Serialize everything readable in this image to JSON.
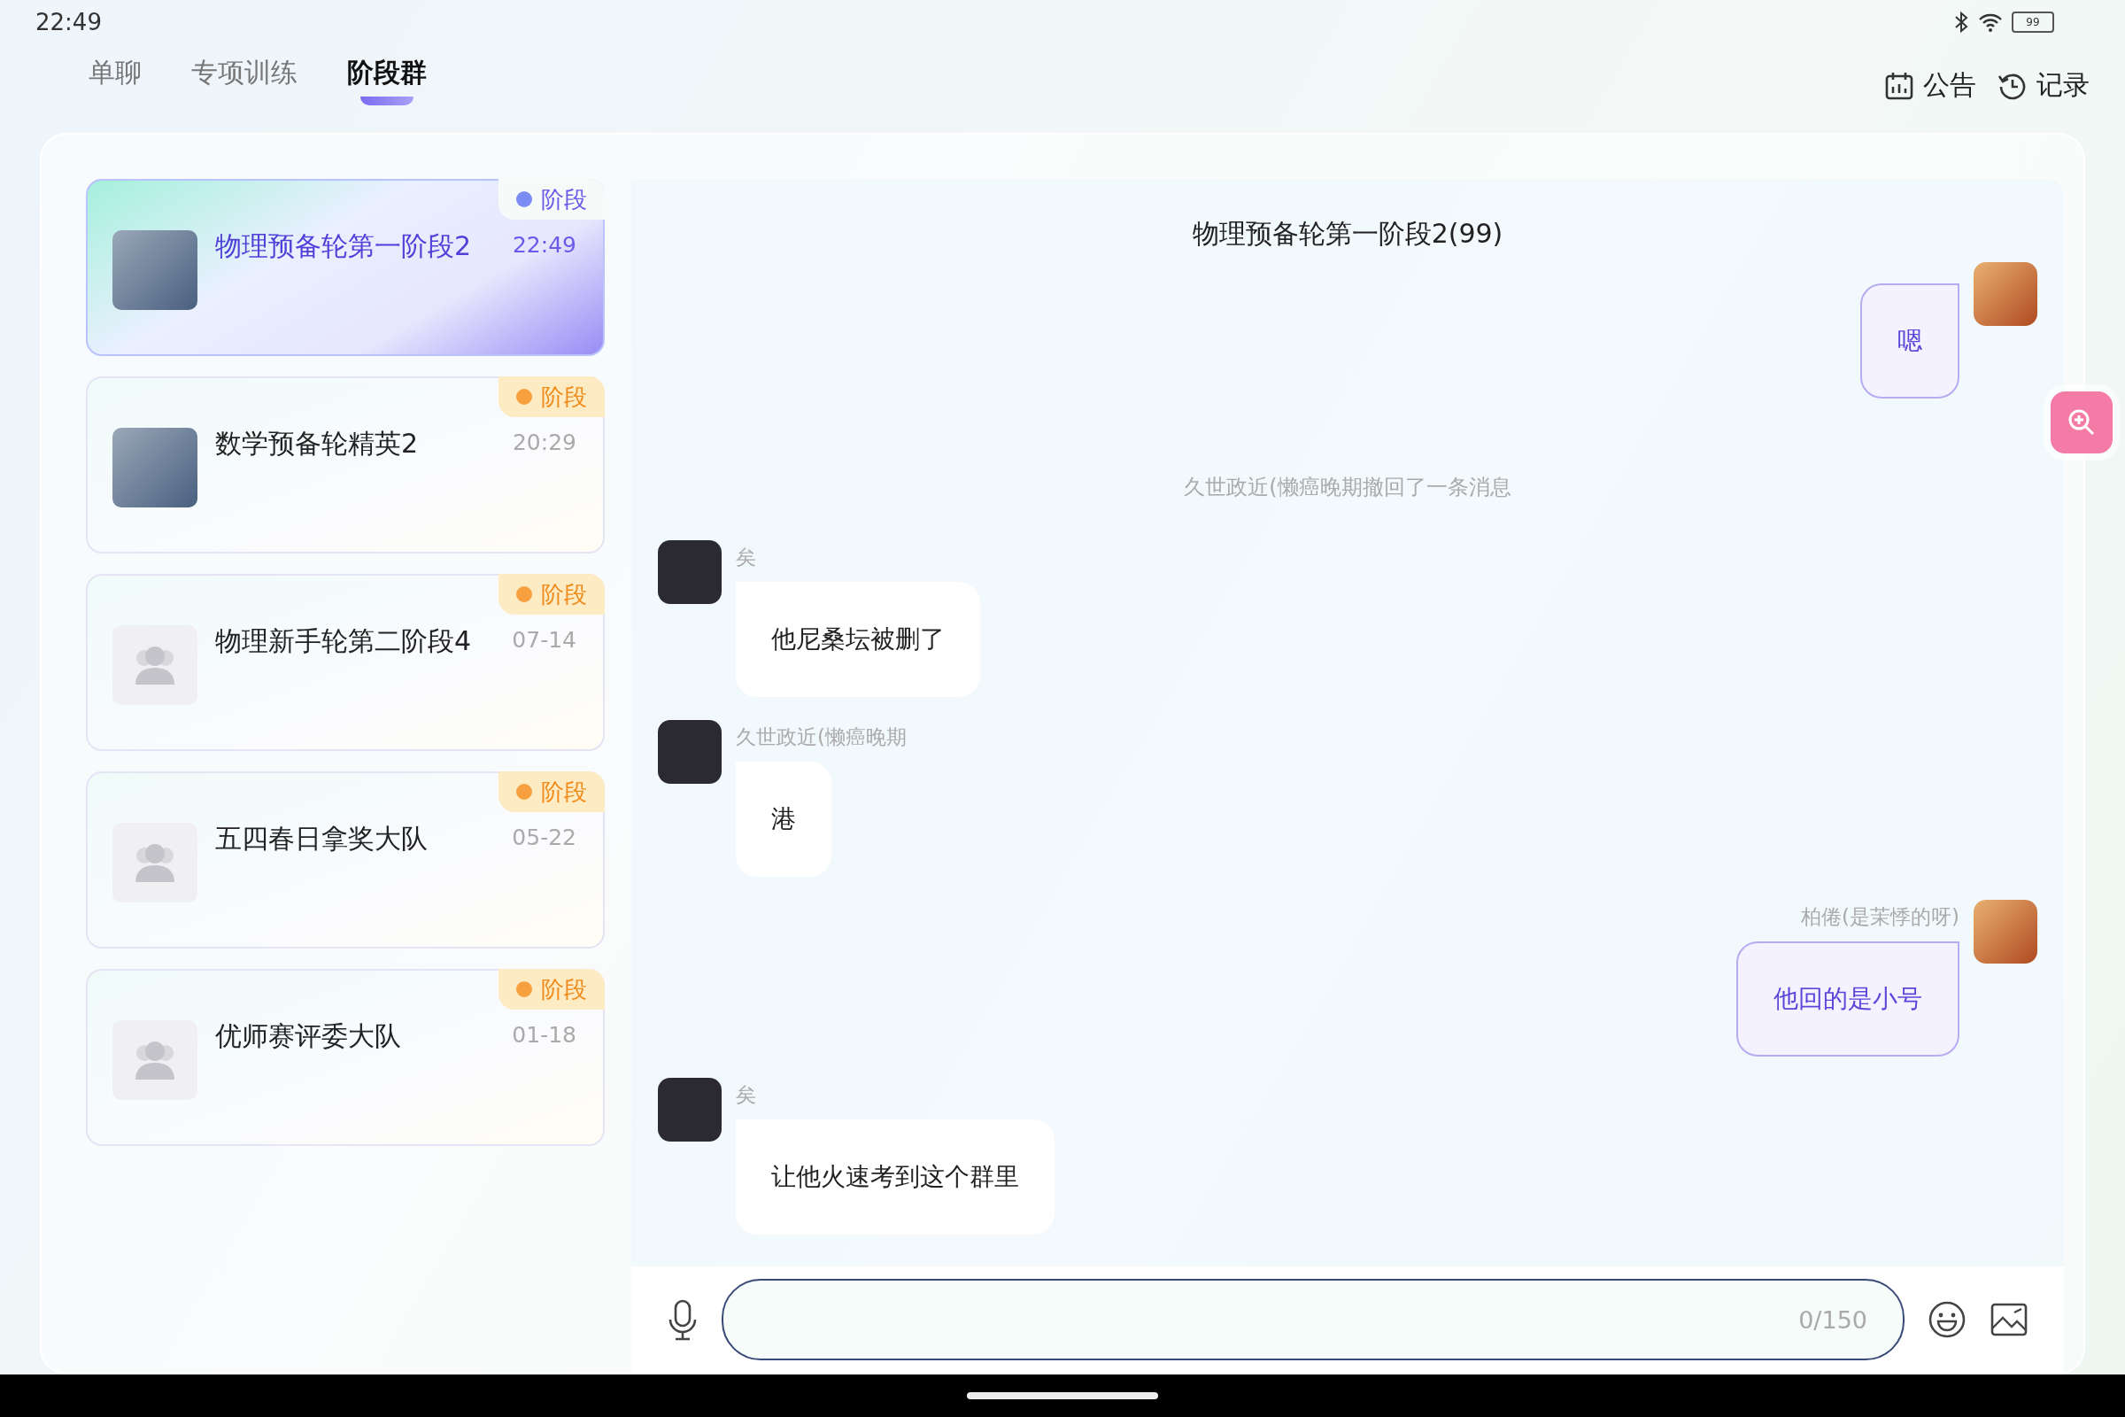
{
  "status_bar": {
    "time": "22:49",
    "battery": "99"
  },
  "tabs": [
    {
      "label": "单聊",
      "selected": false
    },
    {
      "label": "专项训练",
      "selected": false
    },
    {
      "label": "阶段群",
      "selected": true
    }
  ],
  "header_actions": [
    {
      "label": "公告",
      "kind": "calendar"
    },
    {
      "label": "记录",
      "kind": "history"
    }
  ],
  "groups": [
    {
      "name": "物理预备轮第一阶段2",
      "time": "22:49",
      "tag": "阶段",
      "selected": true,
      "kind": "photo"
    },
    {
      "name": "数学预备轮精英2",
      "time": "20:29",
      "tag": "阶段",
      "selected": false,
      "kind": "photo"
    },
    {
      "name": "物理新手轮第二阶段4",
      "time": "07-14",
      "tag": "阶段",
      "selected": false,
      "kind": "default"
    },
    {
      "name": "五四春日拿奖大队",
      "time": "05-22",
      "tag": "阶段",
      "selected": false,
      "kind": "default"
    },
    {
      "name": "优师赛评委大队",
      "time": "01-18",
      "tag": "阶段",
      "selected": false,
      "kind": "default"
    }
  ],
  "chat": {
    "title": "物理预备轮第一阶段2(99)",
    "messages": [
      {
        "kind": "self",
        "text": "嗯"
      },
      {
        "kind": "system",
        "text": "久世政近(懒癌晚期撤回了一条消息"
      },
      {
        "kind": "other",
        "sender": "矣",
        "text": "他尼桑坛被删了"
      },
      {
        "kind": "other",
        "sender": "久世政近(懒癌晚期",
        "text": "港"
      },
      {
        "kind": "self",
        "sender": "柏倦(是茉悸的呀)",
        "text": "他回的是小号"
      },
      {
        "kind": "other",
        "sender": "矣",
        "text": "让他火速考到这个群里"
      }
    ]
  },
  "input": {
    "counter": "0/150"
  }
}
